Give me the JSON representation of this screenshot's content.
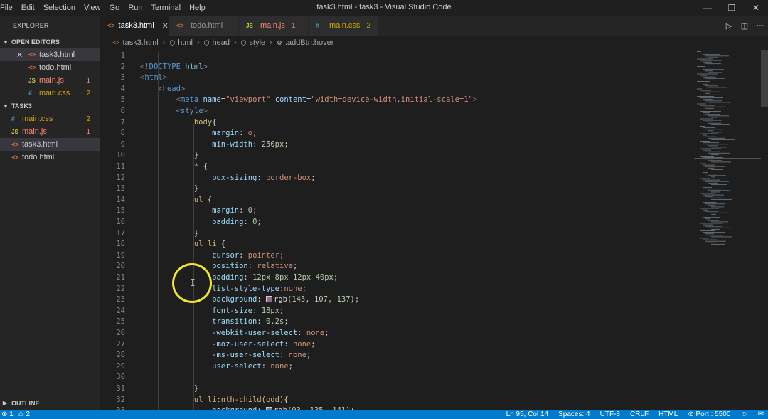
{
  "titlebar": {
    "menu": [
      "File",
      "Edit",
      "Selection",
      "View",
      "Go",
      "Run",
      "Terminal",
      "Help"
    ],
    "title": "task3.html - task3 - Visual Studio Code"
  },
  "sidebar": {
    "header": "EXPLORER",
    "more": "···",
    "open_editors_label": "OPEN EDITORS",
    "open_editors": [
      {
        "name": "task3.html",
        "icon": "html",
        "count": "",
        "active": true,
        "close": true
      },
      {
        "name": "todo.html",
        "icon": "html",
        "count": ""
      },
      {
        "name": "main.js",
        "icon": "js",
        "count": "1",
        "color": "red"
      },
      {
        "name": "main.css",
        "icon": "css",
        "count": "2",
        "color": "yel"
      }
    ],
    "folder_label": "TASK3",
    "files": [
      {
        "name": "main.css",
        "icon": "css",
        "count": "2",
        "color": "yel"
      },
      {
        "name": "main.js",
        "icon": "js",
        "count": "1",
        "color": "red"
      },
      {
        "name": "task3.html",
        "icon": "html",
        "count": "",
        "active": true
      },
      {
        "name": "todo.html",
        "icon": "html",
        "count": ""
      }
    ],
    "outline_label": "OUTLINE"
  },
  "tabs": [
    {
      "name": "task3.html",
      "icon": "html",
      "active": true,
      "close": "✕"
    },
    {
      "name": "todo.html",
      "icon": "html"
    },
    {
      "name": "main.js",
      "icon": "js",
      "count": "1",
      "color": "red"
    },
    {
      "name": "main.css",
      "icon": "css",
      "count": "2",
      "color": "yel"
    }
  ],
  "breadcrumbs": [
    "task3.html",
    "html",
    "head",
    "style",
    ".addBtn:hover"
  ],
  "icon_glyphs": {
    "html": "<>",
    "js": "JS",
    "css": "#"
  },
  "code_lines": [
    {
      "n": "1",
      "t": []
    },
    {
      "n": "2",
      "t": [
        [
          "k",
          "<!"
        ],
        [
          "tg",
          "DOCTYPE"
        ],
        [
          "pn",
          " "
        ],
        [
          "at",
          "html"
        ],
        [
          "k",
          ">"
        ]
      ]
    },
    {
      "n": "3",
      "t": [
        [
          "k",
          "<"
        ],
        [
          "tg",
          "html"
        ],
        [
          "k",
          ">"
        ]
      ]
    },
    {
      "n": "4",
      "t": [
        [
          "pn",
          "    "
        ],
        [
          "k",
          "<"
        ],
        [
          "tg",
          "head"
        ],
        [
          "k",
          ">"
        ]
      ]
    },
    {
      "n": "5",
      "t": [
        [
          "pn",
          "        "
        ],
        [
          "k",
          "<"
        ],
        [
          "tg",
          "meta"
        ],
        [
          "pn",
          " "
        ],
        [
          "at",
          "name"
        ],
        [
          "pn",
          "="
        ],
        [
          "str",
          "\"viewport\""
        ],
        [
          "pn",
          " "
        ],
        [
          "at",
          "content"
        ],
        [
          "pn",
          "="
        ],
        [
          "str",
          "\"width=device-width,initial-scale=1\""
        ],
        [
          "k",
          ">"
        ]
      ]
    },
    {
      "n": "6",
      "t": [
        [
          "pn",
          "        "
        ],
        [
          "k",
          "<"
        ],
        [
          "tg",
          "style"
        ],
        [
          "k",
          ">"
        ]
      ]
    },
    {
      "n": "7",
      "t": [
        [
          "pn",
          "            "
        ],
        [
          "sel",
          "body"
        ],
        [
          "pn",
          "{"
        ]
      ]
    },
    {
      "n": "8",
      "t": [
        [
          "pn",
          "                "
        ],
        [
          "pr",
          "margin"
        ],
        [
          "pn",
          ": "
        ],
        [
          "vl",
          "o"
        ],
        [
          "pn",
          ";"
        ]
      ]
    },
    {
      "n": "9",
      "t": [
        [
          "pn",
          "                "
        ],
        [
          "pr",
          "min-width"
        ],
        [
          "pn",
          ": "
        ],
        [
          "nm",
          "250px"
        ],
        [
          "pn",
          ";"
        ]
      ]
    },
    {
      "n": "10",
      "t": [
        [
          "pn",
          "            }"
        ]
      ]
    },
    {
      "n": "11",
      "t": [
        [
          "pn",
          "            "
        ],
        [
          "sel",
          "*"
        ],
        [
          "pn",
          " {"
        ]
      ]
    },
    {
      "n": "12",
      "t": [
        [
          "pn",
          "                "
        ],
        [
          "pr",
          "box-sizing"
        ],
        [
          "pn",
          ": "
        ],
        [
          "vl",
          "border-box"
        ],
        [
          "pn",
          ";"
        ]
      ]
    },
    {
      "n": "13",
      "t": [
        [
          "pn",
          "            }"
        ]
      ]
    },
    {
      "n": "14",
      "t": [
        [
          "pn",
          "            "
        ],
        [
          "sel",
          "ul"
        ],
        [
          "pn",
          " {"
        ]
      ]
    },
    {
      "n": "15",
      "t": [
        [
          "pn",
          "                "
        ],
        [
          "pr",
          "margin"
        ],
        [
          "pn",
          ": "
        ],
        [
          "nm",
          "0"
        ],
        [
          "pn",
          ";"
        ]
      ]
    },
    {
      "n": "16",
      "t": [
        [
          "pn",
          "                "
        ],
        [
          "pr",
          "padding"
        ],
        [
          "pn",
          ": "
        ],
        [
          "nm",
          "0"
        ],
        [
          "pn",
          ";"
        ]
      ]
    },
    {
      "n": "17",
      "t": [
        [
          "pn",
          "            }"
        ]
      ]
    },
    {
      "n": "18",
      "t": [
        [
          "pn",
          "            "
        ],
        [
          "sel",
          "ul li"
        ],
        [
          "pn",
          " {"
        ]
      ]
    },
    {
      "n": "19",
      "t": [
        [
          "pn",
          "                "
        ],
        [
          "pr",
          "cursor"
        ],
        [
          "pn",
          ": "
        ],
        [
          "vl",
          "pointer"
        ],
        [
          "pn",
          ";"
        ]
      ]
    },
    {
      "n": "20",
      "t": [
        [
          "pn",
          "                "
        ],
        [
          "pr",
          "position"
        ],
        [
          "pn",
          ": "
        ],
        [
          "vl",
          "relative"
        ],
        [
          "pn",
          ";"
        ]
      ]
    },
    {
      "n": "21",
      "t": [
        [
          "pn",
          "                "
        ],
        [
          "pr",
          "padding"
        ],
        [
          "pn",
          ": "
        ],
        [
          "nm",
          "12px 8px 12px 40px"
        ],
        [
          "pn",
          ";"
        ]
      ]
    },
    {
      "n": "22",
      "t": [
        [
          "pn",
          "                "
        ],
        [
          "pr",
          "list-style-type"
        ],
        [
          "pn",
          ":"
        ],
        [
          "vl",
          "none"
        ],
        [
          "pn",
          ";"
        ]
      ]
    },
    {
      "n": "23",
      "t": [
        [
          "pn",
          "                "
        ],
        [
          "pr",
          "background"
        ],
        [
          "pn",
          ": "
        ],
        [
          "swatch",
          "#916b89"
        ],
        [
          "pn",
          "rgb("
        ],
        [
          "nm",
          "145"
        ],
        [
          "pn",
          ", "
        ],
        [
          "nm",
          "107"
        ],
        [
          "pn",
          ", "
        ],
        [
          "nm",
          "137"
        ],
        [
          "pn",
          ");"
        ]
      ]
    },
    {
      "n": "24",
      "t": [
        [
          "pn",
          "                "
        ],
        [
          "pr",
          "font-size"
        ],
        [
          "pn",
          ": "
        ],
        [
          "nm",
          "18px"
        ],
        [
          "pn",
          ";"
        ]
      ]
    },
    {
      "n": "25",
      "t": [
        [
          "pn",
          "                "
        ],
        [
          "pr",
          "transition"
        ],
        [
          "pn",
          ": "
        ],
        [
          "nm",
          "0.2s"
        ],
        [
          "pn",
          ";"
        ]
      ]
    },
    {
      "n": "26",
      "t": [
        [
          "pn",
          "                "
        ],
        [
          "pr",
          "-webkit-user-select"
        ],
        [
          "pn",
          ": "
        ],
        [
          "vl",
          "none"
        ],
        [
          "pn",
          ";"
        ]
      ]
    },
    {
      "n": "27",
      "t": [
        [
          "pn",
          "                "
        ],
        [
          "pr",
          "-moz-user-select"
        ],
        [
          "pn",
          ": "
        ],
        [
          "vl",
          "none"
        ],
        [
          "pn",
          ";"
        ]
      ]
    },
    {
      "n": "28",
      "t": [
        [
          "pn",
          "                "
        ],
        [
          "pr",
          "-ms-user-select"
        ],
        [
          "pn",
          ": "
        ],
        [
          "vl",
          "none"
        ],
        [
          "pn",
          ";"
        ]
      ]
    },
    {
      "n": "29",
      "t": [
        [
          "pn",
          "                "
        ],
        [
          "pr",
          "user-select"
        ],
        [
          "pn",
          ": "
        ],
        [
          "vl",
          "none"
        ],
        [
          "pn",
          ";"
        ]
      ]
    },
    {
      "n": "30",
      "t": []
    },
    {
      "n": "31",
      "t": [
        [
          "pn",
          "            }"
        ]
      ]
    },
    {
      "n": "32",
      "t": [
        [
          "pn",
          "            "
        ],
        [
          "sel",
          "ul li:nth-child(odd)"
        ],
        [
          "pn",
          "{"
        ]
      ]
    },
    {
      "n": "33",
      "t": [
        [
          "pn",
          "                "
        ],
        [
          "pr",
          "background"
        ],
        [
          "pn",
          ": "
        ],
        [
          "swatch",
          "#5d878d"
        ],
        [
          "pn",
          "rgb("
        ],
        [
          "nm",
          "93"
        ],
        [
          "pn",
          ", "
        ],
        [
          "nm",
          "135"
        ],
        [
          "pn",
          ", "
        ],
        [
          "nm",
          "141"
        ],
        [
          "pn",
          ");"
        ]
      ]
    }
  ],
  "status": {
    "errors": "⊗ 1",
    "warnings": "⚠ 2",
    "position": "Ln 95, Col 14",
    "spaces": "Spaces: 4",
    "encoding": "UTF-8",
    "eol": "CRLF",
    "language": "HTML",
    "port": "⊘ Port : 5500"
  },
  "colors": {
    "accent": "#007acc",
    "highlight": "#f0e62a"
  }
}
